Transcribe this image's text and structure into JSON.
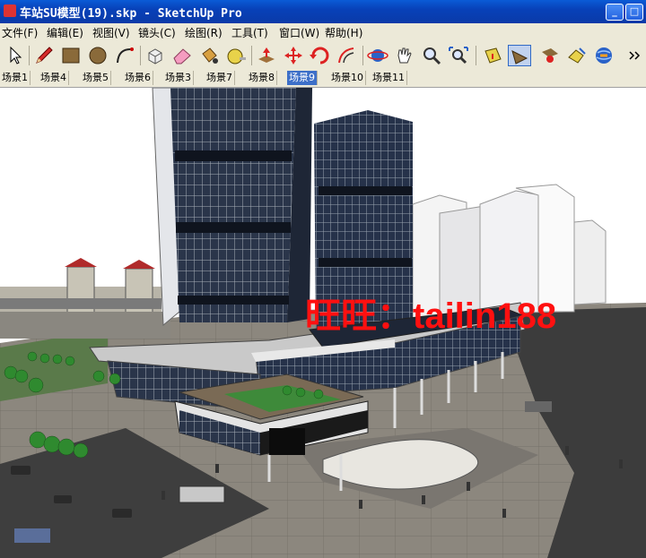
{
  "window": {
    "title": "车站SU模型(19).skp - SketchUp Pro",
    "minimize_label": "_",
    "maximize_label": "□"
  },
  "menu": [
    {
      "label": "文件(F)"
    },
    {
      "label": "编辑(E)"
    },
    {
      "label": "视图(V)"
    },
    {
      "label": "镜头(C)"
    },
    {
      "label": "绘图(R)"
    },
    {
      "label": "工具(T)"
    },
    {
      "label": "窗口(W)"
    },
    {
      "label": "帮助(H)"
    }
  ],
  "toolbar": {
    "tools": [
      "select-icon",
      "pencil-icon",
      "rectangle-icon",
      "circle-icon",
      "arc-icon",
      "make-component-icon",
      "eraser-icon",
      "paint-bucket-icon",
      "tape-measure-icon",
      "push-pull-icon",
      "move-icon",
      "rotate-icon",
      "offset-icon",
      "orbit-icon",
      "pan-icon",
      "zoom-icon",
      "zoom-extents-icon",
      "section-plane-icon",
      "walk-icon",
      "position-camera-icon",
      "look-around-icon",
      "get-models-icon"
    ]
  },
  "scenes": {
    "tabs": [
      "场景1",
      "场景4",
      "场景5",
      "场景6",
      "场景3",
      "场景7",
      "场景8",
      "场景9",
      "场景10",
      "场景11"
    ],
    "active": "场景9"
  },
  "viewport": {
    "watermark": "旺旺：tailin188",
    "colors": {
      "sky": "#ffffff",
      "glass": "#2c3a52",
      "ground": "#8f8a80",
      "road": "#3a3a3a",
      "watermark": "#ff1010"
    }
  }
}
